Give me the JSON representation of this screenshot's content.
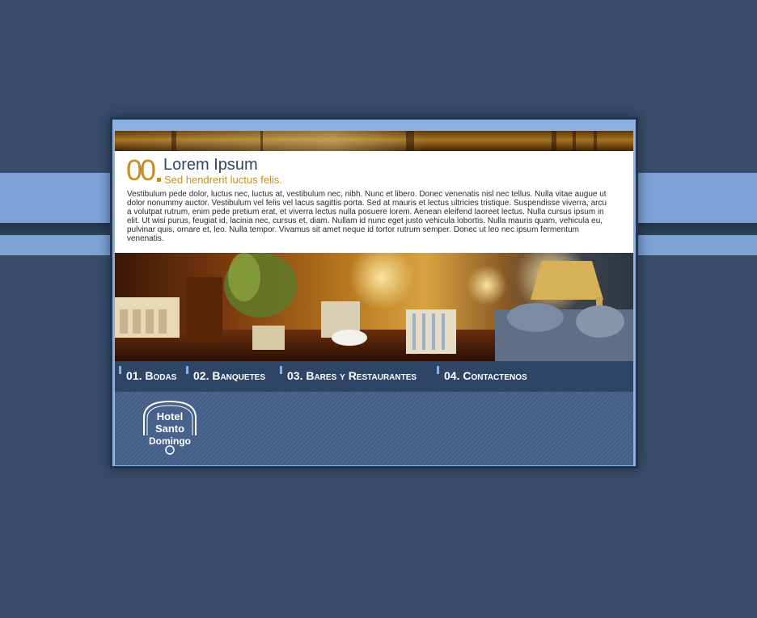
{
  "section": {
    "number": "00",
    "title": "Lorem Ipsum",
    "subtitle": "Sed hendrerit luctus felis.",
    "body": "Vestibulum pede dolor, luctus nec, luctus at, vestibulum nec, nibh. Nunc et libero. Donec venenatis nisl nec tellus. Nulla vitae augue ut dolor nonummy auctor. Vestibulum vel felis vel lacus sagittis porta. Sed at mauris et lectus ultricies tristique. Suspendisse viverra, arcu a volutpat rutrum, enim pede pretium erat, et viverra lectus nulla posuere lorem. Aenean eleifend laoreet lectus. Nulla cursus ipsum in elit. Ut wisi purus, feugiat id, lacinia nec, cursus et, diam. Nullam id nunc eget justo vehicula lobortis. Nulla mauris quam, vehicula eu, pulvinar quis, ornare et, leo. Nulla tempor. Vivamus sit amet neque id tortor rutrum semper. Donec ut leo nec ipsum fermentum venenatis."
  },
  "nav": {
    "items": [
      {
        "label": "01. Bodas"
      },
      {
        "label": "02. Banquetes"
      },
      {
        "label": "03. Bares y Restaurantes"
      },
      {
        "label": "04. Contactenos"
      }
    ]
  },
  "logo": {
    "line1": "Hotel",
    "line2": "Santo",
    "line3": "Domingo"
  },
  "colors": {
    "background": "#374d69",
    "band": "#7ea2d6",
    "accent": "#c58f25",
    "title": "#2f4667",
    "nav": "#2e4565",
    "footer": "#44608a"
  }
}
